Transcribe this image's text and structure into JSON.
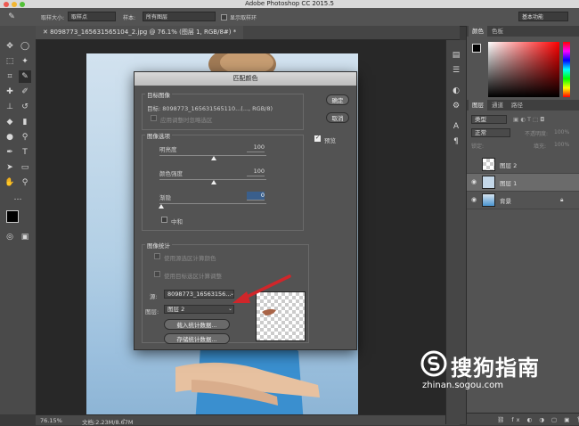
{
  "window": {
    "title": "Adobe Photoshop CC 2015.5"
  },
  "options_bar": {
    "sample_size_label": "取样大小:",
    "sample_size_value": "取样点",
    "sample_label": "样本:",
    "sample_value": "所有图层",
    "show_ring_label": "显示取样环",
    "workspace_value": "基本功能"
  },
  "document": {
    "tab_label": "8098773_165631565104_2.jpg @ 76.1% (图层 1, RGB/8#) *",
    "zoom": "76.15%",
    "doc_size": "文档:2.23M/8.67M"
  },
  "dialog": {
    "title": "匹配颜色",
    "target_group_label": "目标图像",
    "target_text": "目标: 8098773_165631565110...(..., RGB/8)",
    "ignore_selection_label": "应用调整时忽略选区",
    "options_group_label": "图像选项",
    "luminance_label": "明亮度",
    "luminance_value": "100",
    "luminance_level": 0.5,
    "intensity_label": "颜色强度",
    "intensity_value": "100",
    "intensity_level": 0.5,
    "fade_label": "渐隐",
    "fade_value": "0",
    "fade_level": 0.0,
    "neutralize_label": "中和",
    "stats_group_label": "图像统计",
    "use_source_selection_label": "使用源选区计算颜色",
    "use_target_selection_label": "使用目标选区计算调整",
    "source_label": "源:",
    "source_value": "8098773_16563156...",
    "layer_label": "图层:",
    "layer_value": "图层 2",
    "load_stats_button": "载入统计数据...",
    "save_stats_button": "存储统计数据...",
    "ok_button": "确定",
    "cancel_button": "取消",
    "preview_label": "预览"
  },
  "color_panel": {
    "tabs": [
      "颜色",
      "色板"
    ]
  },
  "layers_panel": {
    "tabs": [
      "图层",
      "通道",
      "路径"
    ],
    "search_placeholder": "类型",
    "blend_mode": "正常",
    "opacity_label": "不透明度:",
    "opacity_value": "100%",
    "lock_label": "锁定:",
    "fill_label": "填充:",
    "fill_value": "100%",
    "layers": [
      {
        "name": "图层 2",
        "visible": false,
        "selected": false
      },
      {
        "name": "图层 1",
        "visible": true,
        "selected": true
      },
      {
        "name": "背景",
        "visible": true,
        "selected": false
      }
    ]
  },
  "watermark": {
    "brand": "搜狗指南",
    "url": "zhinan.sogou.com"
  },
  "colors": {
    "accent_arrow": "#d0262a",
    "dialog_bg": "#535353",
    "canvas_bg": "#282828"
  }
}
